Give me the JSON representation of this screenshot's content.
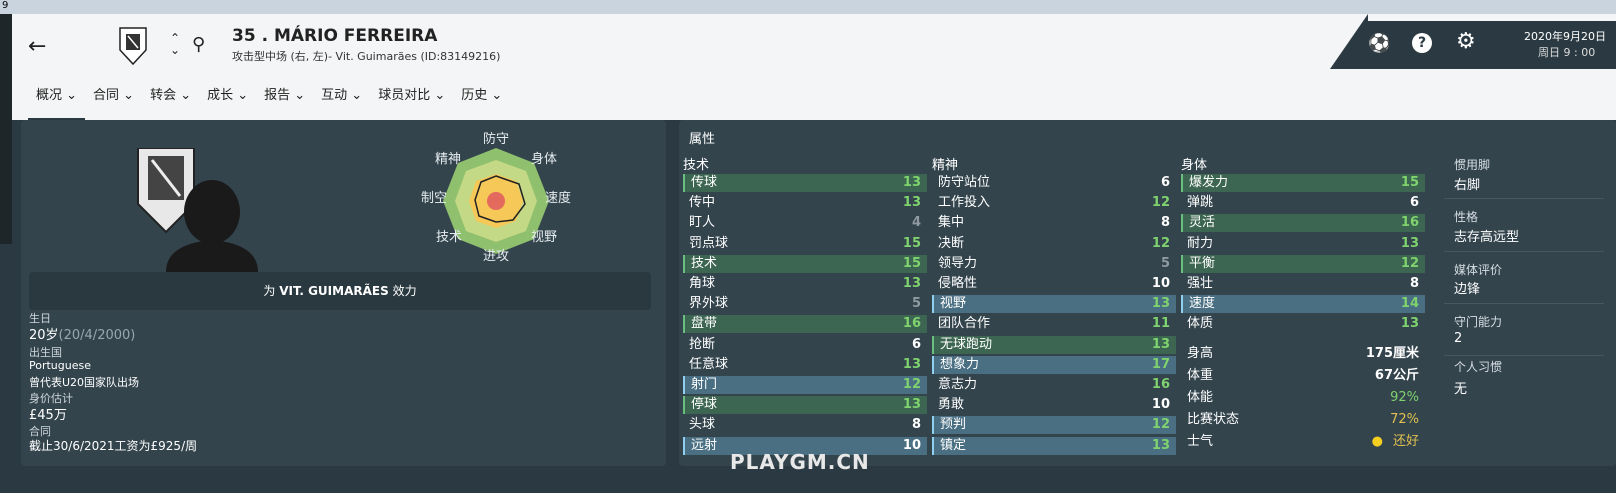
{
  "window": {
    "title": "9"
  },
  "header": {
    "player_name": "35 . MÁRIO FERREIRA",
    "player_sub": "攻击型中场 (右, 左)- Vit. Guimarães (ID:83149216)",
    "date": "2020年9月20日",
    "time": "周日 9 : 00"
  },
  "tabs": [
    "概况 ⌄",
    "合同 ⌄",
    "转会 ⌄",
    "成长 ⌄",
    "报告 ⌄",
    "互动 ⌄",
    "球员对比 ⌄",
    "历史 ⌄"
  ],
  "radar": {
    "labels": {
      "top": "防守",
      "top_right": "身体",
      "right": "速度",
      "bottom_right": "视野",
      "bottom": "进攻",
      "bottom_left": "技术",
      "left": "制空",
      "top_left": "精神"
    }
  },
  "profile": {
    "plays_for_prefix": "为 ",
    "plays_for_club": "VIT. GUIMARÃES",
    "plays_for_suffix": " 效力",
    "birth_label": "生日",
    "age": "20岁",
    "birthdate": "(20/4/2000)",
    "nation_label": "出生国",
    "nation": "Portuguese",
    "caps": "曾代表U20国家队出场",
    "value_label": "身价估计",
    "value": "£45万",
    "contract_label": "合同",
    "contract": "截止30/6/2021工资为£925/周"
  },
  "attributes": {
    "title": "属性",
    "technical_title": "技术",
    "mental_title": "精神",
    "physical_title": "身体",
    "technical": [
      {
        "name": "传球",
        "value": "13",
        "hl": "g"
      },
      {
        "name": "传中",
        "value": "13",
        "hl": ""
      },
      {
        "name": "盯人",
        "value": "4",
        "hl": ""
      },
      {
        "name": "罚点球",
        "value": "15",
        "hl": ""
      },
      {
        "name": "技术",
        "value": "15",
        "hl": "g"
      },
      {
        "name": "角球",
        "value": "13",
        "hl": ""
      },
      {
        "name": "界外球",
        "value": "5",
        "hl": ""
      },
      {
        "name": "盘带",
        "value": "16",
        "hl": "g"
      },
      {
        "name": "抢断",
        "value": "6",
        "hl": ""
      },
      {
        "name": "任意球",
        "value": "13",
        "hl": ""
      },
      {
        "name": "射门",
        "value": "12",
        "hl": "b"
      },
      {
        "name": "停球",
        "value": "13",
        "hl": "g"
      },
      {
        "name": "头球",
        "value": "8",
        "hl": ""
      },
      {
        "name": "远射",
        "value": "10",
        "hl": "b"
      }
    ],
    "mental": [
      {
        "name": "防守站位",
        "value": "6",
        "hl": ""
      },
      {
        "name": "工作投入",
        "value": "12",
        "hl": ""
      },
      {
        "name": "集中",
        "value": "8",
        "hl": ""
      },
      {
        "name": "决断",
        "value": "12",
        "hl": ""
      },
      {
        "name": "领导力",
        "value": "5",
        "hl": ""
      },
      {
        "name": "侵略性",
        "value": "10",
        "hl": ""
      },
      {
        "name": "视野",
        "value": "13",
        "hl": "b"
      },
      {
        "name": "团队合作",
        "value": "11",
        "hl": ""
      },
      {
        "name": "无球跑动",
        "value": "13",
        "hl": "g"
      },
      {
        "name": "想象力",
        "value": "17",
        "hl": "b"
      },
      {
        "name": "意志力",
        "value": "16",
        "hl": ""
      },
      {
        "name": "勇敢",
        "value": "10",
        "hl": ""
      },
      {
        "name": "预判",
        "value": "12",
        "hl": "b"
      },
      {
        "name": "镇定",
        "value": "13",
        "hl": "b"
      }
    ],
    "physical": [
      {
        "name": "爆发力",
        "value": "15",
        "hl": "g"
      },
      {
        "name": "弹跳",
        "value": "6",
        "hl": ""
      },
      {
        "name": "灵活",
        "value": "16",
        "hl": "g"
      },
      {
        "name": "耐力",
        "value": "13",
        "hl": ""
      },
      {
        "name": "平衡",
        "value": "12",
        "hl": "g"
      },
      {
        "name": "强壮",
        "value": "8",
        "hl": ""
      },
      {
        "name": "速度",
        "value": "14",
        "hl": "b"
      },
      {
        "name": "体质",
        "value": "13",
        "hl": ""
      }
    ],
    "extra": [
      {
        "name": "身高",
        "value": "175厘米"
      },
      {
        "name": "体重",
        "value": "67公斤"
      },
      {
        "name": "体能",
        "value": "92%"
      },
      {
        "name": "比赛状态",
        "value": "72%"
      },
      {
        "name": "士气",
        "value": "还好"
      }
    ]
  },
  "side": {
    "foot_label": "惯用脚",
    "foot": "右脚",
    "personality_label": "性格",
    "personality": "志存高远型",
    "media_label": "媒体评价",
    "media": "边锋",
    "gk_label": "守门能力",
    "gk": "2",
    "habits_label": "个人习惯",
    "habits": "无"
  },
  "watermark": "PLAYGM.CN",
  "colors": {
    "panel": "#33444d",
    "green_hl": "#3d6652",
    "blue_hl": "#4a6f82",
    "value_green": "#7fd36e",
    "fitness": "#7fd36e",
    "form": "#e0c050"
  }
}
